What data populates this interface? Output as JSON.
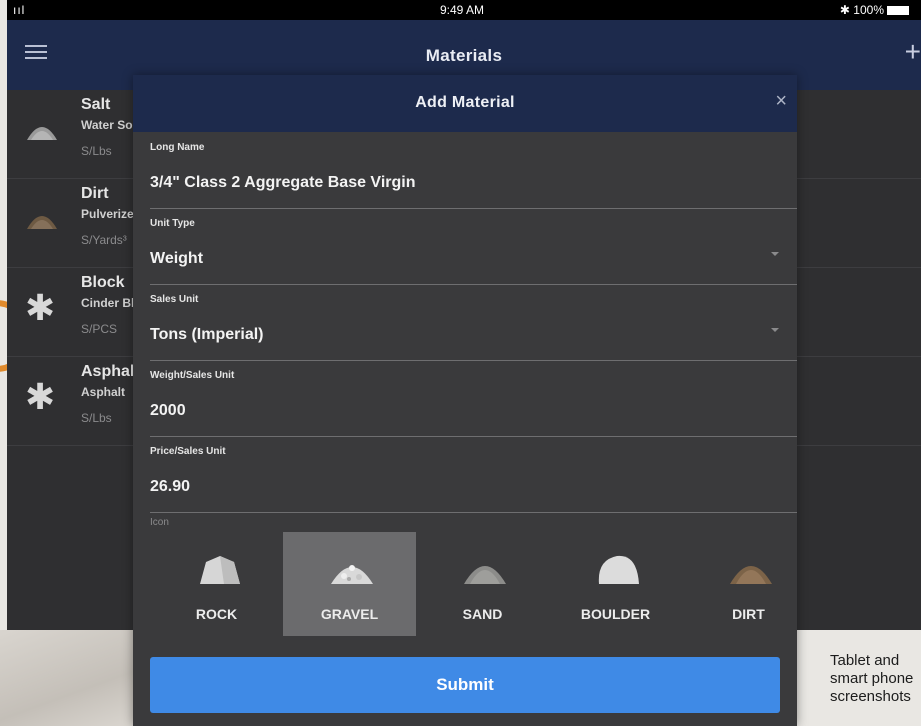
{
  "statusbar": {
    "signal": "ııl",
    "time": "9:49 AM",
    "battery": "✱ 100%"
  },
  "navbar": {
    "title": "Materials",
    "add": "+"
  },
  "list": [
    {
      "name": "Salt",
      "desc": "Water So",
      "unit": "S/Lbs",
      "icon": "salt-pile-icon"
    },
    {
      "name": "Dirt",
      "desc": "Pulverize",
      "unit": "S/Yards³",
      "icon": "dirt-pile-icon"
    },
    {
      "name": "Block",
      "desc": "Cinder Bl",
      "unit": "S/PCS",
      "icon": "star-icon"
    },
    {
      "name": "Asphalt",
      "desc": "Asphalt",
      "unit": "S/Lbs",
      "icon": "star-icon"
    }
  ],
  "modal": {
    "title": "Add Material",
    "close": "×",
    "fields": [
      {
        "label": "Long Name",
        "value": "3/4\" Class 2 Aggregate Base Virgin",
        "dropdown": false
      },
      {
        "label": "Unit Type",
        "value": "Weight",
        "dropdown": true
      },
      {
        "label": "Sales Unit",
        "value": "Tons (Imperial)",
        "dropdown": true
      },
      {
        "label": "Weight/Sales Unit",
        "value": "2000",
        "dropdown": false
      },
      {
        "label": "Price/Sales Unit",
        "value": "26.90",
        "dropdown": false
      }
    ],
    "icon_label": "Icon",
    "icons": [
      {
        "label": "ROCK",
        "selected": false
      },
      {
        "label": "GRAVEL",
        "selected": true
      },
      {
        "label": "SAND",
        "selected": false
      },
      {
        "label": "BOULDER",
        "selected": false
      },
      {
        "label": "DIRT",
        "selected": false
      }
    ],
    "submit": "Submit"
  },
  "caption": "Tablet and smart phone screenshots",
  "colors": {
    "navbar": "#1d2a4c",
    "background": "#2f2f31",
    "modal": "#3a3a3c",
    "submit": "#3f8ae6",
    "selected_tile": "#6b6b6d",
    "accent_orange": "#e08a2c"
  }
}
